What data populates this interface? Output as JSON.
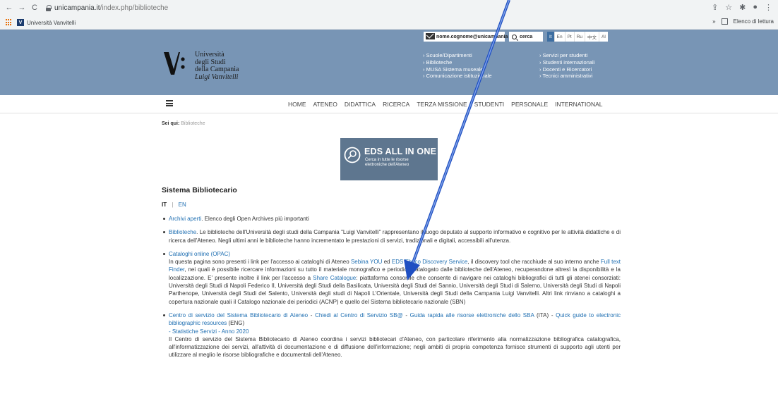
{
  "browser": {
    "url_host": "unicampania.it",
    "url_path": "/index.php/biblioteche",
    "bookmark": "Università Vanvitelli",
    "reading_list_prefix": "»",
    "reading_list": "Elenco di lettura"
  },
  "header": {
    "logo_lines": [
      "Università",
      "degli Studi",
      "della Campania",
      "Luigi Vanvitelli"
    ],
    "email": "nome.cognome@unicampania",
    "search_label": "cerca",
    "languages": [
      "It",
      "En",
      "Pt",
      "Ru",
      "中文",
      "Al"
    ],
    "links_col1": [
      "Scuole/Dipartimenti",
      "Biblioteche",
      "MUSA Sistema museale",
      "Comunicazione istituzionale"
    ],
    "links_col2": [
      "Servizi per studenti",
      "Studenti internazionali",
      "Docenti e Ricercatori",
      "Tecnici amministrativi"
    ]
  },
  "nav": {
    "items": [
      "HOME",
      "ATENEO",
      "DIDATTICA",
      "RICERCA",
      "TERZA MISSIONE",
      "STUDENTI",
      "PERSONALE",
      "INTERNATIONAL"
    ]
  },
  "breadcrumb": {
    "label": "Sei qui:",
    "current": "Biblioteche"
  },
  "eds": {
    "title": "EDS ALL IN ONE",
    "sub1": "Cerca in tutte le risorse",
    "sub2": "elettroniche dell'Ateneo"
  },
  "content": {
    "title": "Sistema Bibliotecario",
    "lang_it": "IT",
    "lang_sep": "|",
    "lang_en": "EN",
    "item1_link": "Archivi aperti",
    "item1_text": ". Elenco degli Open Archives più importanti",
    "item2_link": "Biblioteche",
    "item2_text": ". Le biblioteche dell'Università degli studi della Campania \"Luigi Vanvitelli\" rappresentano il luogo deputato al supporto informativo e cognitivo per le attività didattiche e di ricerca dell'Ateneo. Negli ultimi anni le biblioteche hanno incrementato le prestazioni di servizi, tradizionali e digitali, accessibili all'utenza.",
    "item3_link": "Cataloghi online (OPAC)",
    "item3_a": "In questa pagina sono presenti i link per l'accesso ai cataloghi di Ateneo ",
    "item3_l1": "Sebina YOU",
    "item3_b": " ed ",
    "item3_l2": "EDS Ebsco Discovery Service",
    "item3_c": ", il discovery tool che racchiude al suo interno anche ",
    "item3_l3": "Full text Finder",
    "item3_d": ", nei quali è possibile ricercare informazioni su tutto il materiale monografico e periodico catalogato dalle biblioteche dell'Ateneo, recuperandone altresì la disponibilità e la localizzazione. E' presente inoltre il link per l'accesso a ",
    "item3_l4": "Share Catalogue",
    "item3_e": ": piattaforma consortile che consente di navigare nei cataloghi bibliografici di tutti gli atenei consorziati: Università degli Studi di Napoli Federico II, Università degli Studi della Basilicata, Università degli Studi del Sannio, Università degli Studi di Salerno, Università degli Studi di Napoli Parthenope, Università degli Studi del Salento, Università degli studi di Napoli L'Orientale, Università degli Studi della Campania Luigi Vanvitelli. Altri link rinviano a cataloghi a copertura nazionale quali il Catalogo nazionale dei periodici (ACNP) e quello del Sistema bibliotecario nazionale (SBN)",
    "item4_l1": "Centro di servizio del Sistema Bibliotecario di Ateneo",
    "item4_s1": " - ",
    "item4_l2": "Chiedi al Centro di Servizio SB@",
    "item4_s2": " - ",
    "item4_l3": "Guida rapida alle risorse elettroniche dello SBA",
    "item4_t1": " (ITA) - ",
    "item4_l4": "Quick guide to electronic bibliographic resources",
    "item4_t2": " (ENG)",
    "item4_l5": "- Statistiche Servizi - Anno 2020",
    "item4_text": "Il Centro di servizio del Sistema Bibliotecario di Ateneo coordina i servizi bibliotecari d'Ateneo, con particolare riferimento alla normalizzazione bibliografica catalografica, all'informatizzazione dei servizi, all'attività di documentazione e di diffusione dell'informazione; negli ambiti di propria competenza fornisce strumenti di supporto agli utenti per utilizzare al meglio le risorse bibliografiche e documentali dell'Ateneo."
  },
  "colors": {
    "header_bg": "#7895b5",
    "link": "#1f6fb2",
    "arrow": "#1f4fc2"
  }
}
